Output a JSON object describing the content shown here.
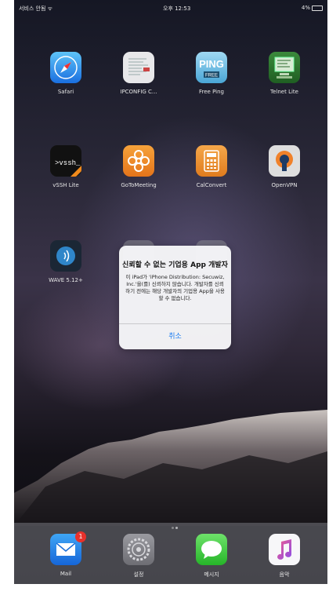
{
  "status_bar": {
    "carrier": "서비스 안됨 ᯤ",
    "time": "오후 12:53",
    "battery": "4%"
  },
  "home_apps": [
    {
      "label": "Safari",
      "icon": "safari-compass-icon"
    },
    {
      "label": "IPCONFIG C...",
      "icon": "ipconfig-document-icon"
    },
    {
      "label": "Free Ping",
      "icon": "ping-free-icon"
    },
    {
      "label": "Telnet Lite",
      "icon": "telnet-monitor-icon"
    },
    {
      "label": "vSSH Lite",
      "icon": "vssh-terminal-icon"
    },
    {
      "label": "GoToMeeting",
      "icon": "gotomeeting-flower-icon"
    },
    {
      "label": "CalConvert",
      "icon": "calculator-icon"
    },
    {
      "label": "OpenVPN",
      "icon": "openvpn-keyhole-icon"
    },
    {
      "label": "WAVE 5.12+",
      "icon": "wave-signal-icon"
    }
  ],
  "alert": {
    "title": "신뢰할 수 없는 기업용 App 개발자",
    "message": "이 iPad가 'iPhone Distribution: Secuwiz, Inc.'을(를) 신뢰하지 않습니다. 개발자를 신뢰하기 전에는 해당 개발자의 기업용 App을 사용할 수 없습니다.",
    "cancel_label": "취소",
    "button_color": "#1a7cf2"
  },
  "page_indicator": {
    "pages": 2,
    "current": 2
  },
  "dock": {
    "apps": [
      {
        "label": "Mail",
        "icon": "mail-envelope-icon",
        "badge": "1"
      },
      {
        "label": "설정",
        "icon": "settings-gear-icon"
      },
      {
        "label": "메시지",
        "icon": "messages-bubble-icon"
      },
      {
        "label": "음악",
        "icon": "music-note-icon"
      }
    ]
  }
}
